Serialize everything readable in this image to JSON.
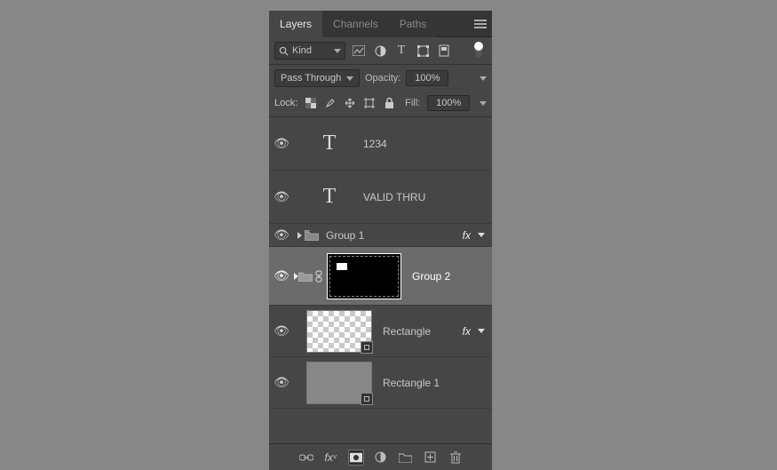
{
  "tabs": {
    "layers": "Layers",
    "channels": "Channels",
    "paths": "Paths"
  },
  "filter": {
    "label": "Kind"
  },
  "blend": {
    "mode": "Pass Through",
    "opacityLabel": "Opacity:",
    "opacityValue": "100%"
  },
  "lock": {
    "label": "Lock:",
    "fillLabel": "Fill:",
    "fillValue": "100%"
  },
  "layers": {
    "l1": "1234",
    "l2": "VALID THRU",
    "g1": "Group 1",
    "g2": "Group 2",
    "r1": "Rectangle",
    "r2": "Rectangle 1",
    "fx": "fx"
  }
}
